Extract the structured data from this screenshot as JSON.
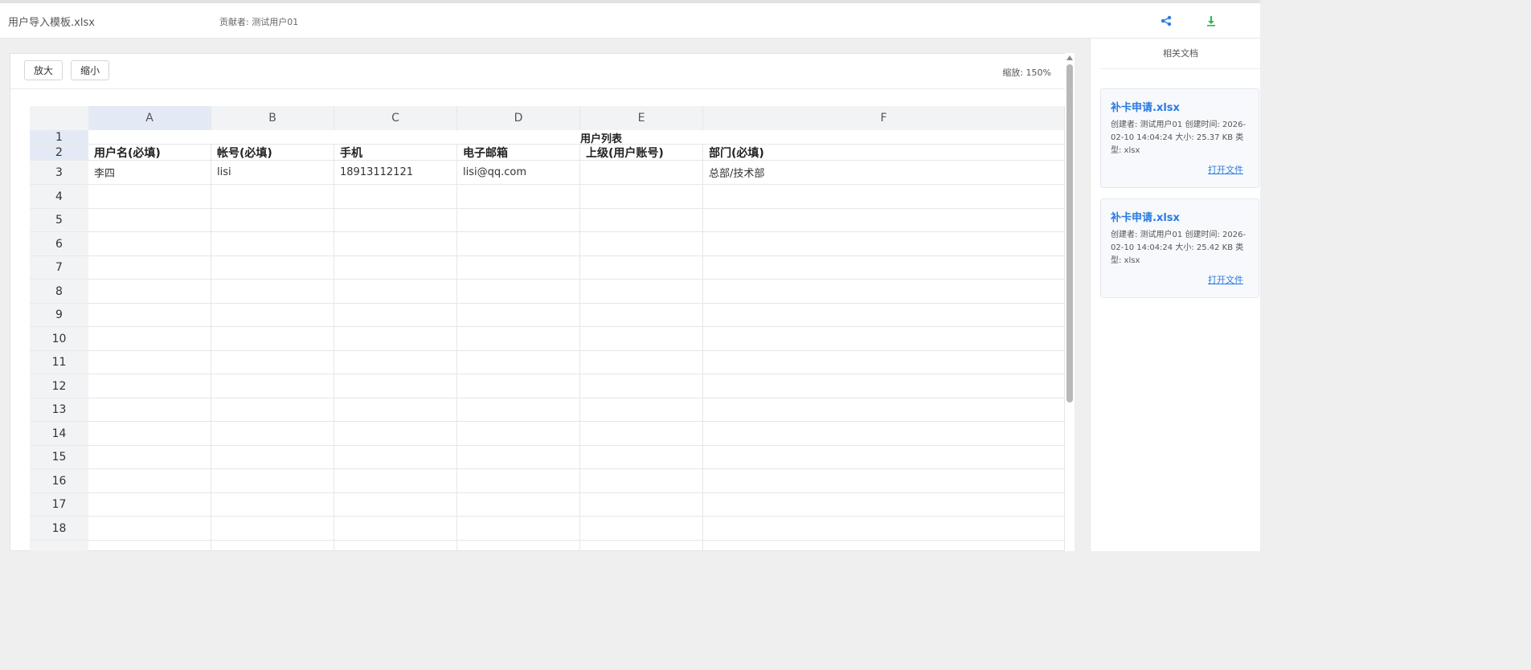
{
  "header": {
    "file_title": "用户导入模板.xlsx",
    "contributor": "贡献者: 测试用户01",
    "share_icon": "share-icon",
    "download_icon": "download-icon",
    "share_color": "#2a7ae2",
    "download_color": "#2db84d"
  },
  "toolbar": {
    "zoom_in_label": "放大",
    "zoom_out_label": "缩小",
    "zoom_level": "缩放: 150%"
  },
  "sheet": {
    "columns": [
      "A",
      "B",
      "C",
      "D",
      "E",
      "F"
    ],
    "rows": [
      "1",
      "2",
      "3",
      "4",
      "5",
      "6",
      "7",
      "8",
      "9",
      "10",
      "11",
      "12",
      "13",
      "14",
      "15",
      "16",
      "17",
      "18"
    ],
    "title": "用户列表",
    "headers": [
      "用户名(必填)",
      "帐号(必填)",
      "手机",
      "电子邮箱",
      "上级(用户账号)",
      "部门(必填)"
    ],
    "row3": [
      "李四",
      "lisi",
      "18913112121",
      "lisi@qq.com",
      "",
      "总部/技术部"
    ]
  },
  "sidebar": {
    "title": "相关文档",
    "docs": [
      {
        "name": "补卡申请.xlsx",
        "meta": "创建者: 测试用户01    创建时间: 2026-02-10 14:04:24    大小: 25.37 KB    类型: xlsx",
        "open_label": "打开文件"
      },
      {
        "name": "补卡申请.xlsx",
        "meta": "创建者: 测试用户01    创建时间: 2026-02-10 14:04:24    大小: 25.42 KB    类型: xlsx",
        "open_label": "打开文件"
      }
    ]
  }
}
